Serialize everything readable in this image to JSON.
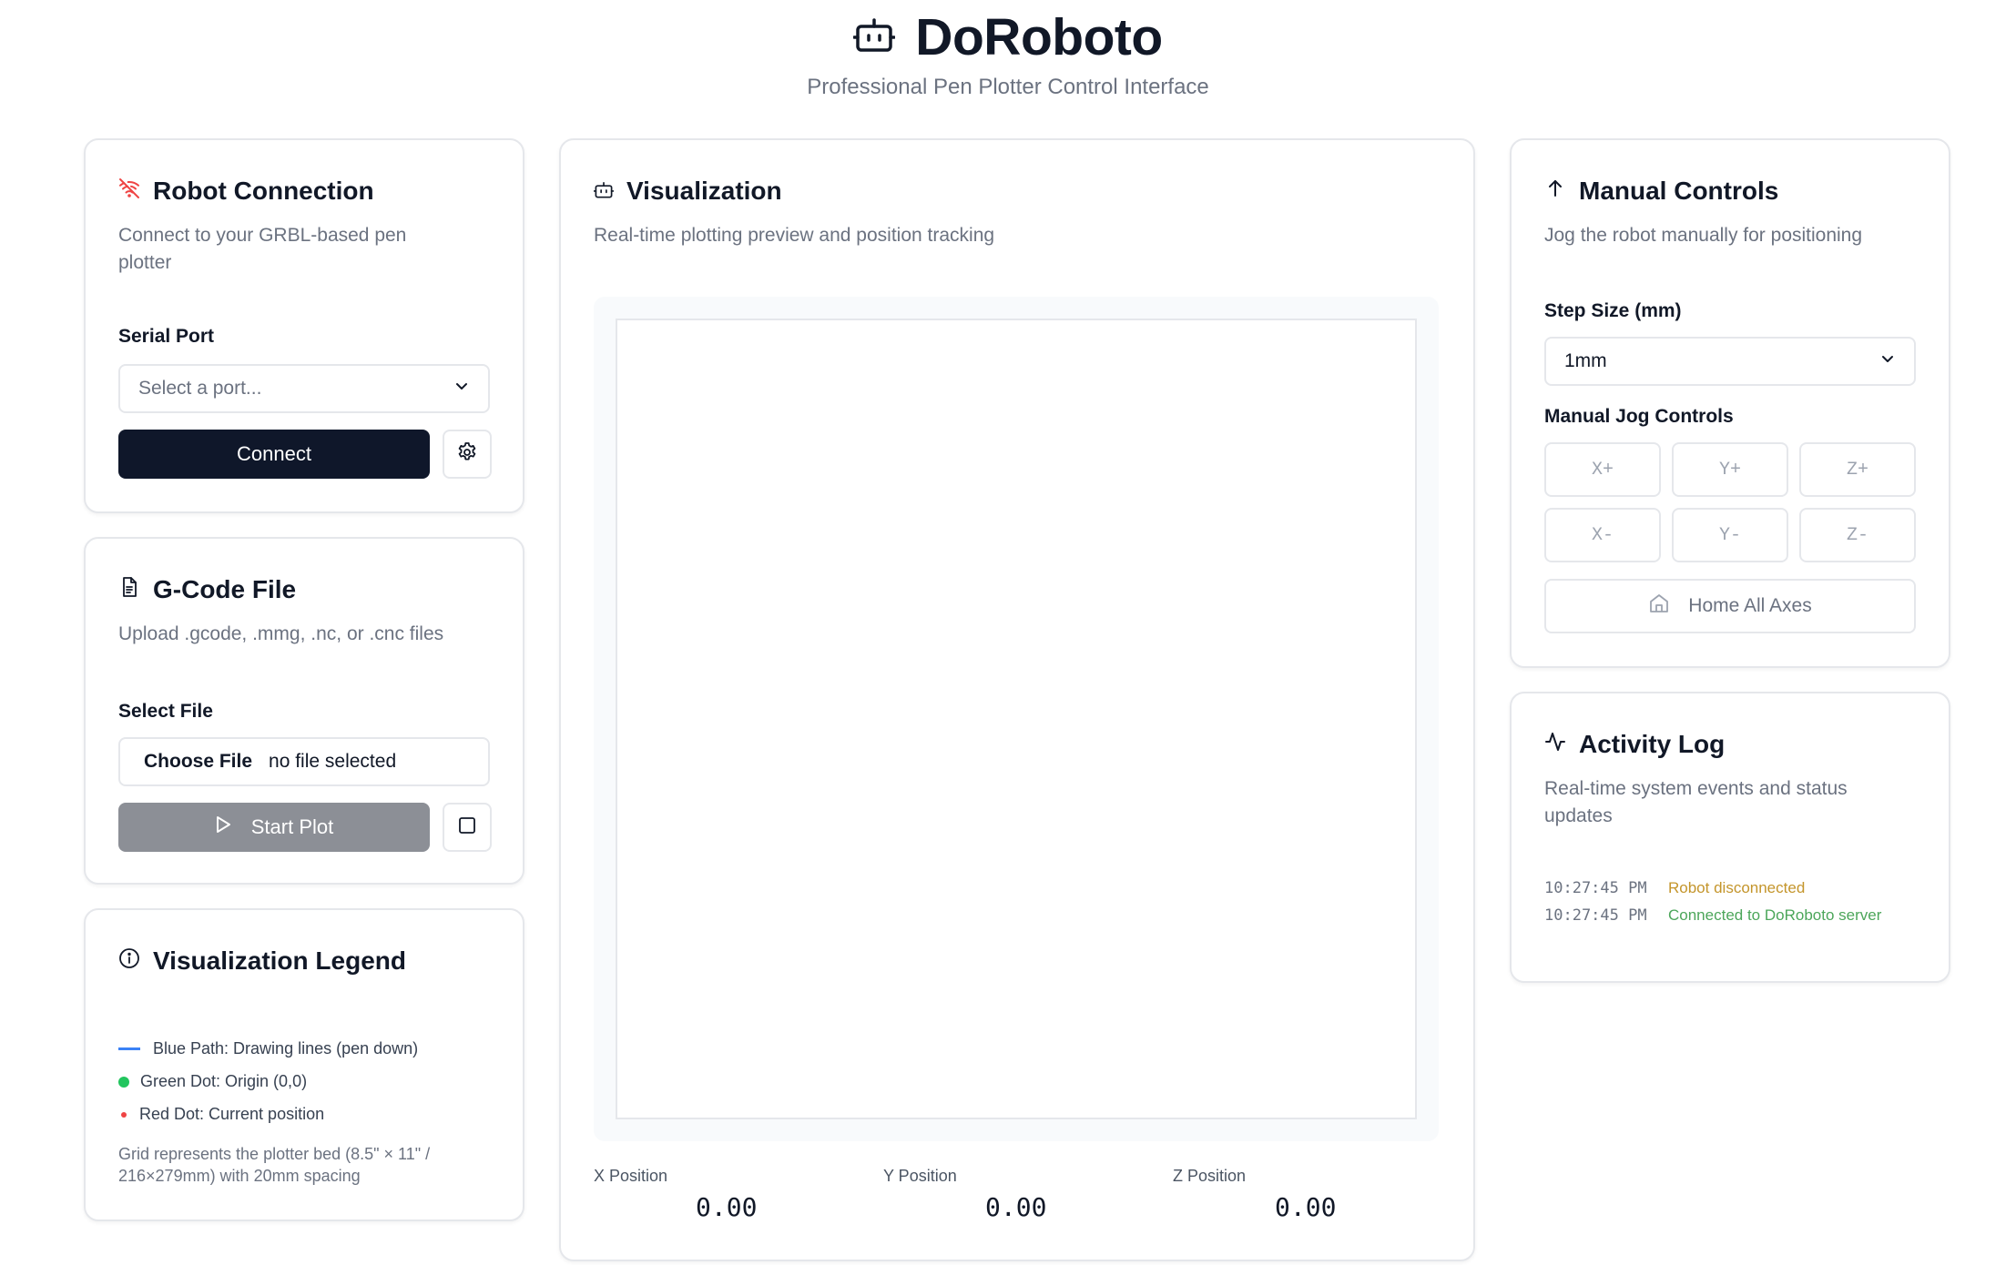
{
  "app": {
    "title": "DoRoboto",
    "subtitle": "Professional Pen Plotter Control Interface"
  },
  "connection": {
    "title": "Robot Connection",
    "description": "Connect to your GRBL-based pen plotter",
    "port_label": "Serial Port",
    "port_placeholder": "Select a port...",
    "connect_label": "Connect"
  },
  "gcode": {
    "title": "G-Code File",
    "description": "Upload .gcode, .mmg, .nc, or .cnc files",
    "file_label": "Select File",
    "choose_label": "Choose File",
    "file_status": "no file selected",
    "start_label": "Start Plot"
  },
  "legend": {
    "title": "Visualization Legend",
    "items": [
      {
        "label": "Blue Path: Drawing lines (pen down)",
        "color": "#3b82f6"
      },
      {
        "label": "Green Dot: Origin (0,0)",
        "color": "#22c55e"
      },
      {
        "label": "Red Dot: Current position",
        "color": "#ef4444"
      }
    ],
    "note": "Grid represents the plotter bed (8.5\" × 11\" / 216×279mm) with 20mm spacing"
  },
  "visualization": {
    "title": "Visualization",
    "description": "Real-time plotting preview and position tracking",
    "positions": [
      {
        "label": "X Position",
        "value": "0.00"
      },
      {
        "label": "Y Position",
        "value": "0.00"
      },
      {
        "label": "Z Position",
        "value": "0.00"
      }
    ]
  },
  "manual": {
    "title": "Manual Controls",
    "description": "Jog the robot manually for positioning",
    "step_label": "Step Size (mm)",
    "step_value": "1mm",
    "jog_label": "Manual Jog Controls",
    "jog_buttons": [
      "X+",
      "Y+",
      "Z+",
      "X-",
      "Y-",
      "Z-"
    ],
    "home_label": "Home All Axes"
  },
  "log": {
    "title": "Activity Log",
    "description": "Real-time system events and status updates",
    "entries": [
      {
        "time": "10:27:45 PM",
        "message": "Robot disconnected",
        "color": "#c4952b"
      },
      {
        "time": "10:27:45 PM",
        "message": "Connected to DoRoboto server",
        "color": "#4ca65a"
      }
    ]
  },
  "colors": {
    "primary": "#0f172a",
    "disconnected_icon": "#ef4444",
    "muted": "#6b7280",
    "border": "#e5e7eb"
  }
}
